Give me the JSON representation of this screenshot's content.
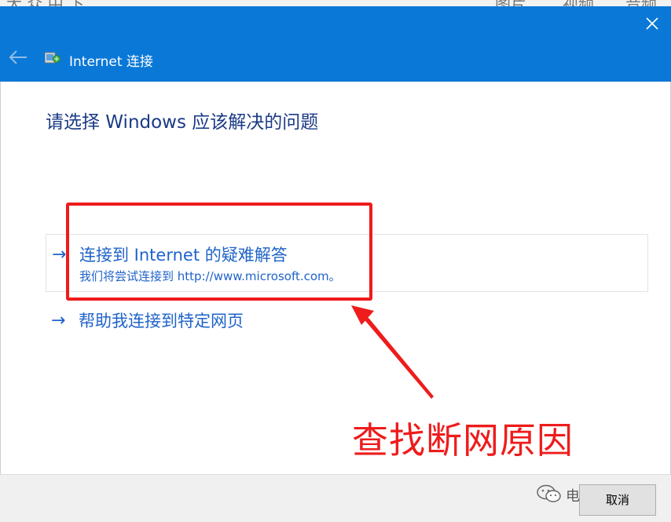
{
  "background": {
    "strip_texts": [
      "大 众 中 下",
      "图片",
      "视频",
      "音频"
    ]
  },
  "window": {
    "title": "Internet 连接",
    "close_icon": "close-icon",
    "back_icon": "back-arrow-icon",
    "app_icon": "network-connection-icon",
    "accent_color": "#0a78d7"
  },
  "main": {
    "heading": "请选择 Windows 应该解决的问题",
    "options": [
      {
        "arrow": "→",
        "title": "连接到 Internet 的疑难解答",
        "description": "我们将尝试连接到 http://www.microsoft.com。"
      },
      {
        "arrow": "→",
        "title": "帮助我连接到特定网页"
      }
    ]
  },
  "annotation": {
    "text": "查找断网原因",
    "color": "#ee1c1c"
  },
  "footer": {
    "cancel_label": "取消"
  },
  "watermark": {
    "text": "电脑专家团",
    "icon": "wechat-icon"
  }
}
